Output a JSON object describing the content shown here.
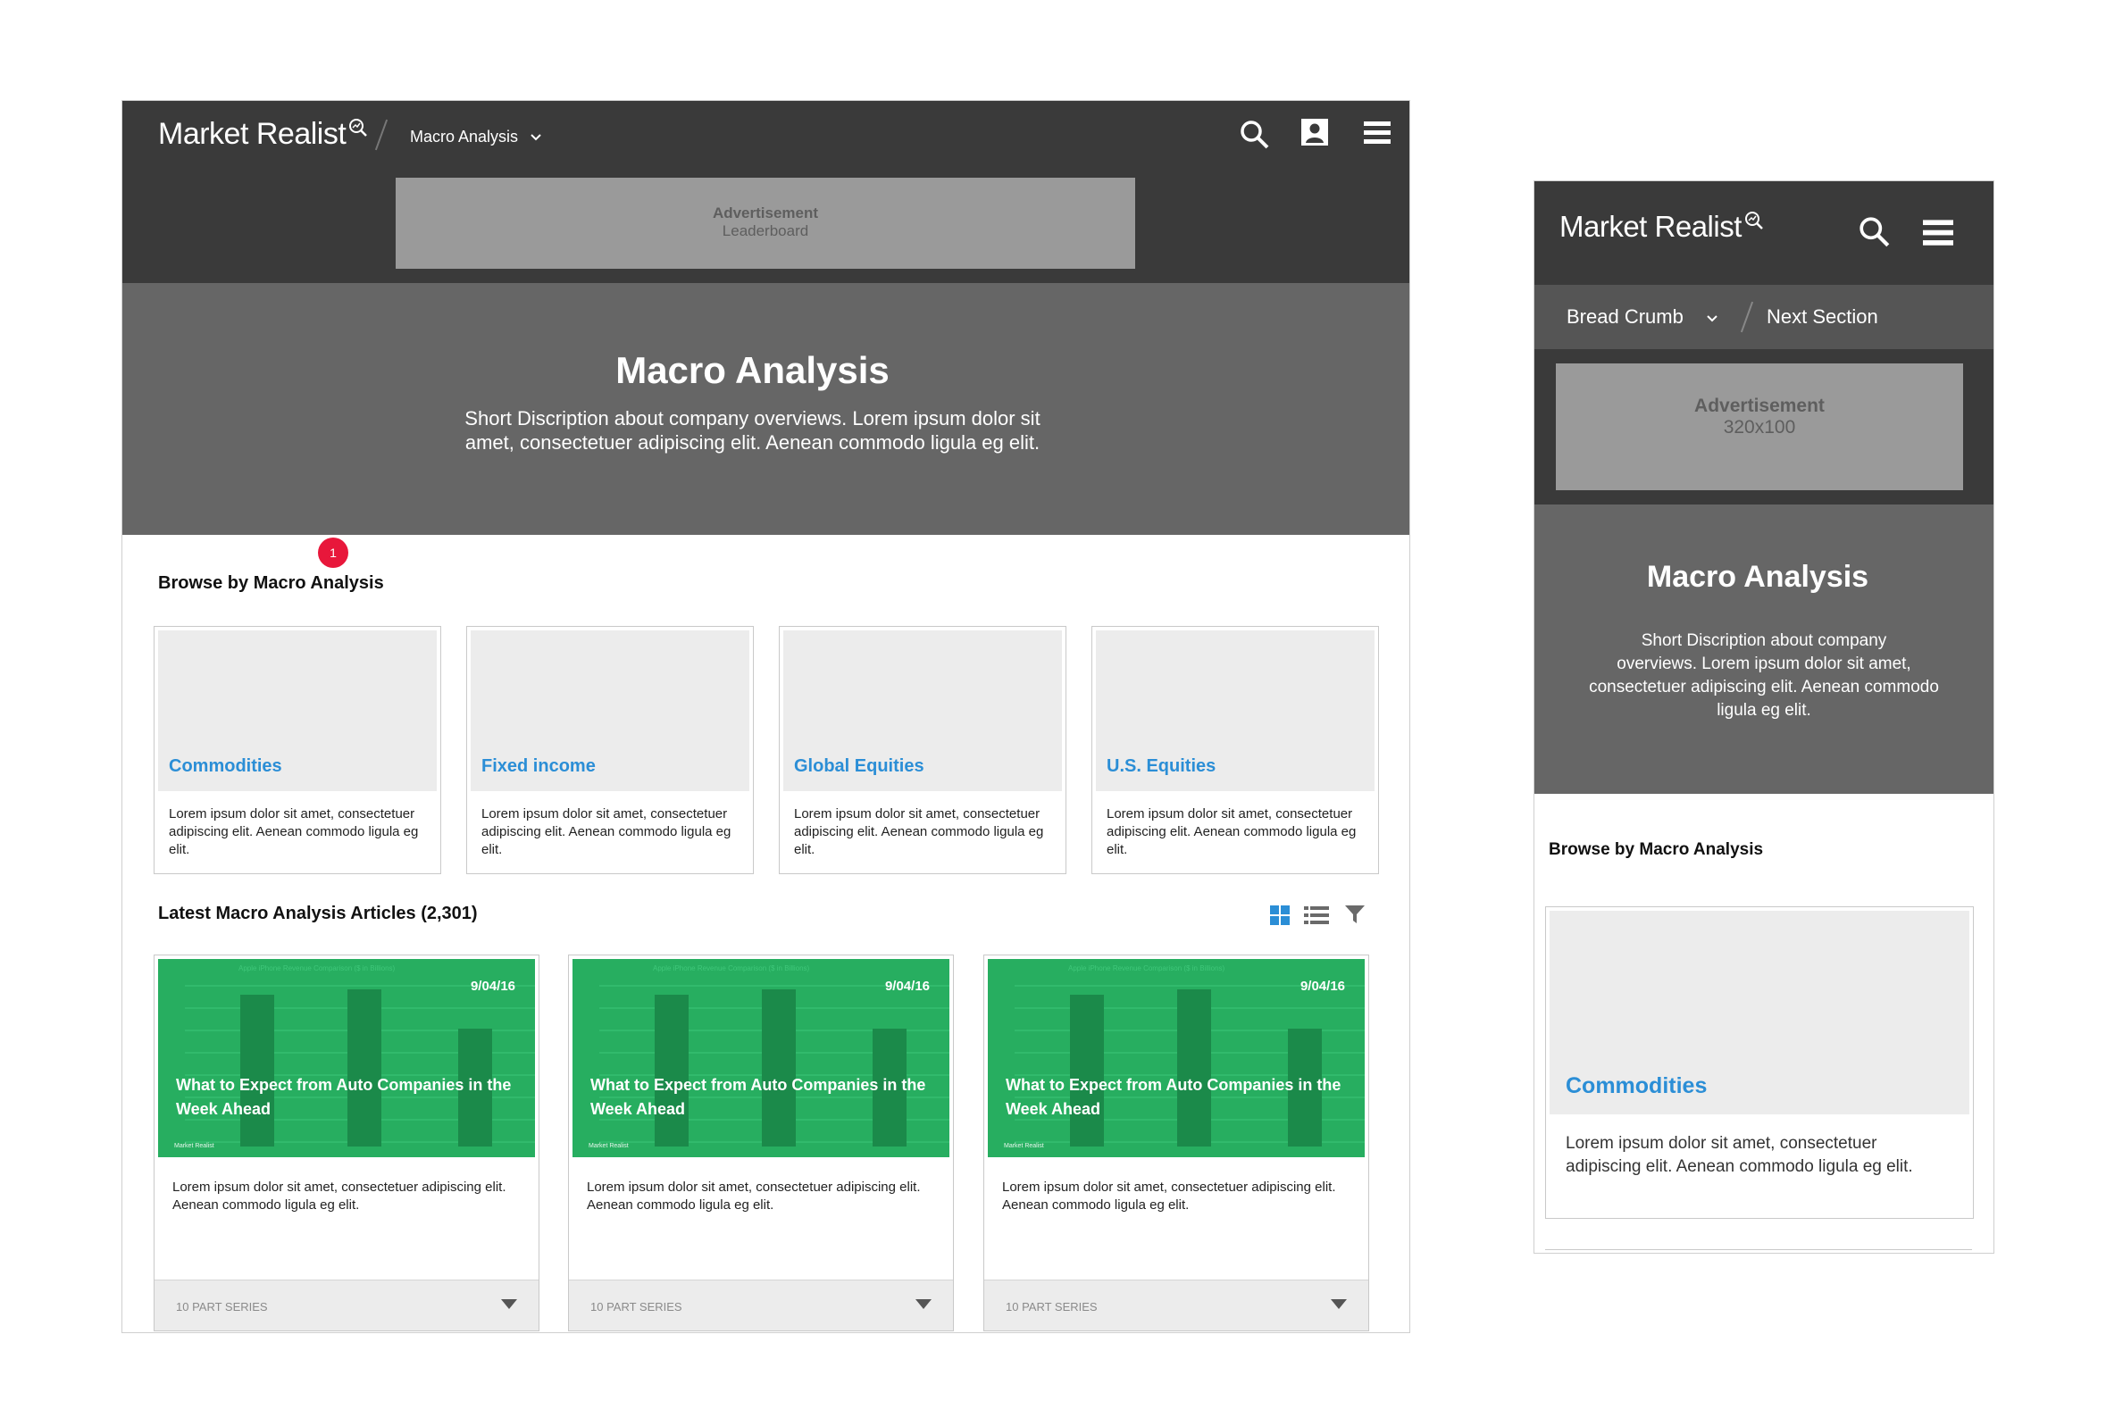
{
  "desktop": {
    "brand": "Market Realist",
    "breadcrumb": "Macro Analysis",
    "ad": {
      "line1": "Advertisement",
      "line2": "Leaderboard"
    },
    "hero": {
      "title": "Macro Analysis",
      "line1": "Short Discription about company overviews. Lorem ipsum dolor sit",
      "line2": "amet, consectetuer adipiscing elit. Aenean commodo ligula eg elit."
    },
    "badge": "1",
    "browse_title": "Browse by Macro Analysis",
    "categories": [
      {
        "title": "Commodities",
        "desc": "Lorem ipsum dolor sit amet, consectetuer adipiscing elit. Aenean commodo ligula eg elit."
      },
      {
        "title": "Fixed income",
        "desc": "Lorem ipsum dolor sit amet, consectetuer adipiscing elit. Aenean commodo ligula eg elit."
      },
      {
        "title": "Global Equities",
        "desc": "Lorem ipsum dolor sit amet, consectetuer adipiscing elit. Aenean commodo ligula eg elit."
      },
      {
        "title": "U.S. Equities",
        "desc": "Lorem ipsum dolor sit amet, consectetuer adipiscing elit. Aenean commodo ligula eg elit."
      }
    ],
    "latest_title": "Latest Macro Analysis Articles (2,301)",
    "articles": [
      {
        "date": "9/04/16",
        "headline": "What to Expect from Auto Companies in the Week Ahead",
        "excerpt": "Lorem ipsum dolor sit amet, consectetuer adipiscing elit. Aenean commodo ligula eg elit.",
        "series": "10 PART SERIES",
        "thumb_title": "Apple iPhone Revenue Comparison ($ in Billions)",
        "thumb_brand": "Market Realist"
      },
      {
        "date": "9/04/16",
        "headline": "What to Expect from Auto Companies in the Week Ahead",
        "excerpt": "Lorem ipsum dolor sit amet, consectetuer adipiscing elit. Aenean commodo ligula eg elit.",
        "series": "10 PART SERIES",
        "thumb_title": "Apple iPhone Revenue Comparison ($ in Billions)",
        "thumb_brand": "Market Realist"
      },
      {
        "date": "9/04/16",
        "headline": "What to Expect from Auto Companies in the Week Ahead",
        "excerpt": "Lorem ipsum dolor sit amet, consectetuer adipiscing elit. Aenean commodo ligula eg elit.",
        "series": "10 PART SERIES",
        "thumb_title": "Apple iPhone Revenue Comparison ($ in Billions)",
        "thumb_brand": "Market Realist"
      }
    ],
    "icons": {
      "search": "search-icon",
      "account": "account-icon",
      "menu": "hamburger-menu-icon",
      "grid": "grid-view-icon",
      "list": "list-view-icon",
      "filter": "filter-icon"
    },
    "colors": {
      "nav": "#3a3a3a",
      "hero": "#666666",
      "link": "#2b8ed6",
      "thumb": "#27ae60",
      "badge": "#e8173b"
    }
  },
  "mobile": {
    "brand": "Market Realist",
    "breadcrumb": "Bread Crumb",
    "next_section": "Next Section",
    "ad": {
      "line1": "Advertisement",
      "line2": "320x100"
    },
    "hero": {
      "title": "Macro Analysis",
      "line1": "Short Discription about company",
      "line2": "overviews. Lorem ipsum dolor sit amet,",
      "line3": "consectetuer adipiscing elit. Aenean commodo",
      "line4": "ligula eg elit."
    },
    "browse_title": "Browse by Macro Analysis",
    "card": {
      "title": "Commodities",
      "line1": "Lorem ipsum dolor sit amet, consectetuer",
      "line2": "adipiscing elit. Aenean commodo ligula eg elit."
    }
  }
}
